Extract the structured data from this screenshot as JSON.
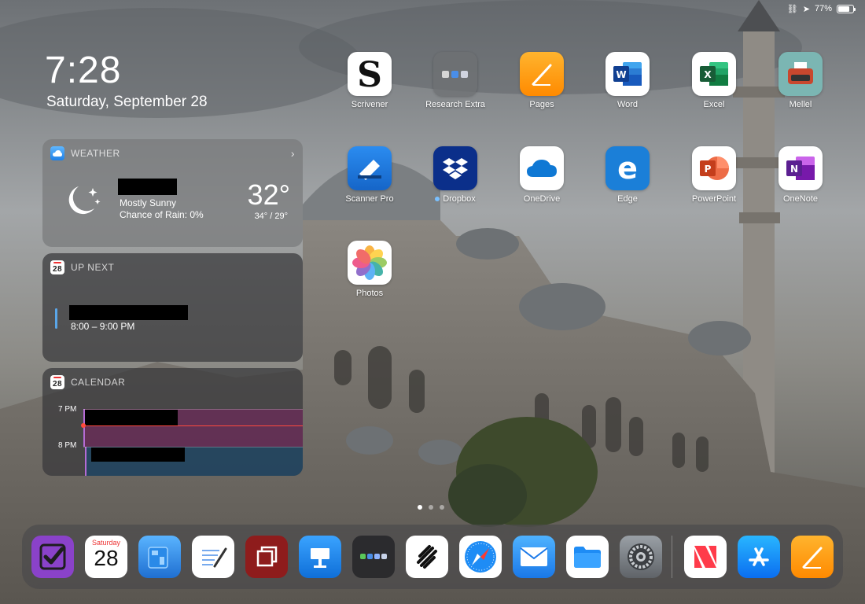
{
  "status_bar": {
    "battery_percent": "77%",
    "battery_level": 0.77
  },
  "clock": {
    "time": "7:28",
    "date": "Saturday, September 28"
  },
  "widgets": {
    "weather": {
      "title": "WEATHER",
      "condition": "Mostly Sunny",
      "rain": "Chance of Rain: 0%",
      "temp": "32°",
      "range": "34° / 29°"
    },
    "up_next": {
      "title": "UP NEXT",
      "icon_day": "28",
      "event_time": "8:00 – 9:00 PM"
    },
    "calendar": {
      "title": "CALENDAR",
      "icon_day": "28",
      "hours": [
        "7 PM",
        "8 PM"
      ]
    }
  },
  "apps": [
    {
      "label": "Scrivener",
      "icon": "scrivener-icon"
    },
    {
      "label": "Research Extra",
      "icon": "folder-icon"
    },
    {
      "label": "Pages",
      "icon": "pages-icon"
    },
    {
      "label": "Word",
      "icon": "word-icon"
    },
    {
      "label": "Excel",
      "icon": "excel-icon"
    },
    {
      "label": "Mellel",
      "icon": "typewriter-icon"
    },
    {
      "label": "Scanner Pro",
      "icon": "scanner-icon"
    },
    {
      "label": "Dropbox",
      "icon": "dropbox-icon",
      "new_badge": true
    },
    {
      "label": "OneDrive",
      "icon": "onedrive-icon"
    },
    {
      "label": "Edge",
      "icon": "edge-icon"
    },
    {
      "label": "PowerPoint",
      "icon": "powerpoint-icon"
    },
    {
      "label": "OneNote",
      "icon": "onenote-icon"
    },
    {
      "label": "Photos",
      "icon": "photos-icon"
    }
  ],
  "dock": {
    "calendar_day_name": "Saturday",
    "calendar_day": "28",
    "apps": [
      "omnifocus-icon",
      "calendar-icon",
      "blueprint-icon",
      "notes-pen-icon",
      "frame-icon",
      "keynote-icon",
      "folder-icon",
      "squarespace-icon",
      "safari-icon",
      "mail-icon",
      "files-icon",
      "settings-icon",
      "news-icon",
      "app-store-icon",
      "pages-icon"
    ]
  },
  "colors": {
    "accent_blue": "#1e7fe6",
    "now_line": "#ff4a3d"
  }
}
